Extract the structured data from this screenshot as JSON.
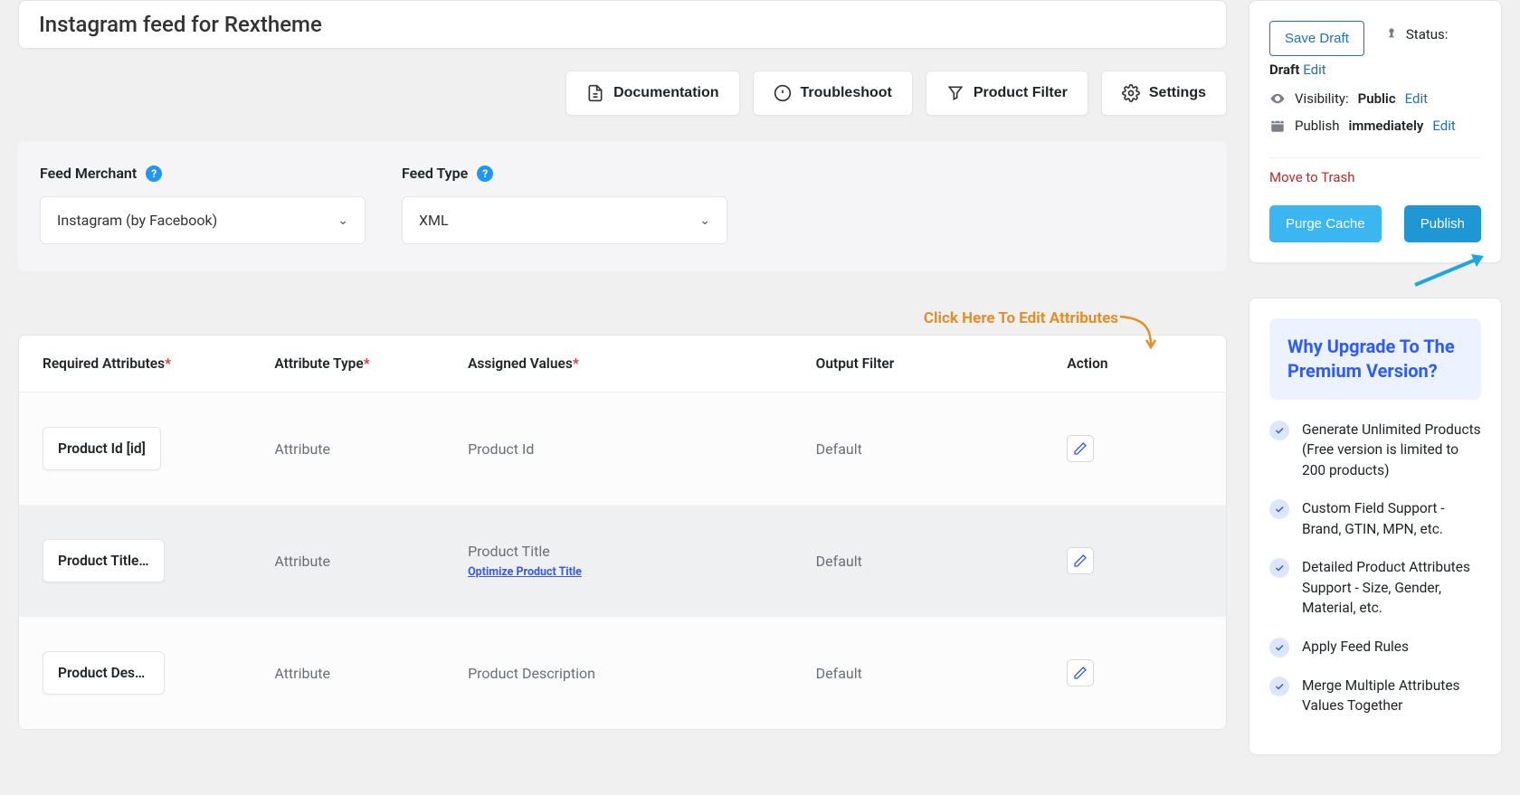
{
  "title": "Instagram feed for Rextheme",
  "toolbar": {
    "documentation": "Documentation",
    "troubleshoot": "Troubleshoot",
    "product_filter": "Product Filter",
    "settings": "Settings"
  },
  "feed_merchant": {
    "label": "Feed Merchant",
    "value": "Instagram (by Facebook)"
  },
  "feed_type": {
    "label": "Feed Type",
    "value": "XML"
  },
  "edit_hint": "Click Here To Edit Attributes",
  "table": {
    "headers": {
      "req_attr": "Required Attributes",
      "attr_type": "Attribute Type",
      "assigned": "Assigned Values",
      "output_filter": "Output Filter",
      "action": "Action"
    },
    "rows": [
      {
        "attr": "Product Id [id]",
        "type": "Attribute",
        "assigned": "Product Id",
        "filter": "Default",
        "optimize": null
      },
      {
        "attr": "Product Title …",
        "type": "Attribute",
        "assigned": "Product Title",
        "filter": "Default",
        "optimize": "Optimize Product Title"
      },
      {
        "attr": "Product Desc…",
        "type": "Attribute",
        "assigned": "Product Description",
        "filter": "Default",
        "optimize": null
      }
    ]
  },
  "publish_box": {
    "save_draft": "Save Draft",
    "status_label": "Status:",
    "status_value": "Draft",
    "edit": "Edit",
    "visibility_label": "Visibility:",
    "visibility_value": "Public",
    "publish_label": "Publish",
    "publish_value": "immediately",
    "trash": "Move to Trash",
    "purge_cache": "Purge Cache",
    "publish_btn": "Publish"
  },
  "upgrade": {
    "title": "Why Upgrade To The Premium Version?",
    "features": [
      "Generate Unlimited Products (Free version is limited to 200 products)",
      "Custom Field Support - Brand, GTIN, MPN, etc.",
      "Detailed Product Attributes Support - Size, Gender, Material, etc.",
      "Apply Feed Rules",
      "Merge Multiple Attributes Values Together"
    ]
  }
}
